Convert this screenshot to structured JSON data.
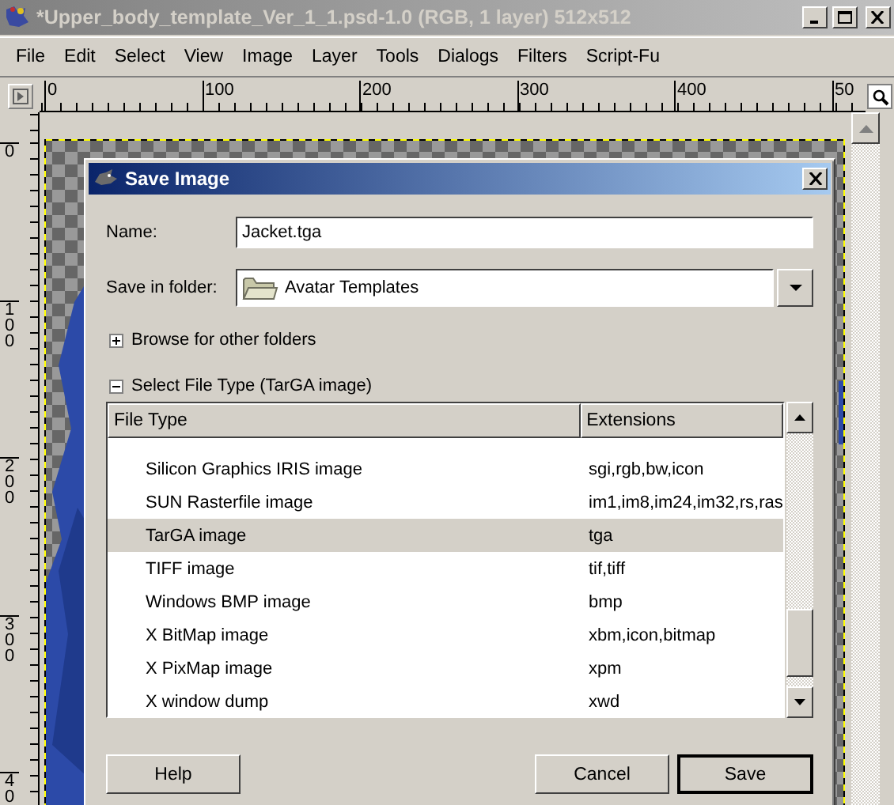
{
  "window": {
    "title": "*Upper_body_template_Ver_1_1.psd-1.0 (RGB, 1 layer) 512x512",
    "menu": [
      "File",
      "Edit",
      "Select",
      "View",
      "Image",
      "Layer",
      "Tools",
      "Dialogs",
      "Filters",
      "Script-Fu"
    ]
  },
  "rulers": {
    "horizontal": [
      "0",
      "100",
      "200",
      "300",
      "400",
      "50"
    ],
    "vertical": [
      "0",
      "100",
      "200",
      "300",
      "40"
    ]
  },
  "dialog": {
    "title": "Save Image",
    "name_label": "Name:",
    "name_value": "Jacket.tga",
    "folder_label": "Save in folder:",
    "folder": "Avatar Templates",
    "browse": {
      "label": "Browse for other folders",
      "expanded": false
    },
    "file_type": {
      "label": "Select File Type (TarGA image)",
      "expanded": true
    },
    "table": {
      "columns": [
        "File Type",
        "Extensions"
      ],
      "rows": [
        {
          "type": "Silicon Graphics IRIS image",
          "extensions": "sgi,rgb,bw,icon",
          "selected": false
        },
        {
          "type": "SUN Rasterfile image",
          "extensions": "im1,im8,im24,im32,rs,ras",
          "selected": false
        },
        {
          "type": "TarGA image",
          "extensions": "tga",
          "selected": true
        },
        {
          "type": "TIFF image",
          "extensions": "tif,tiff",
          "selected": false
        },
        {
          "type": "Windows BMP image",
          "extensions": "bmp",
          "selected": false
        },
        {
          "type": "X BitMap image",
          "extensions": "xbm,icon,bitmap",
          "selected": false
        },
        {
          "type": "X PixMap image",
          "extensions": "xpm",
          "selected": false
        },
        {
          "type": "X window dump",
          "extensions": "xwd",
          "selected": false
        }
      ]
    },
    "buttons": [
      "Help",
      "Cancel",
      "Save"
    ]
  }
}
